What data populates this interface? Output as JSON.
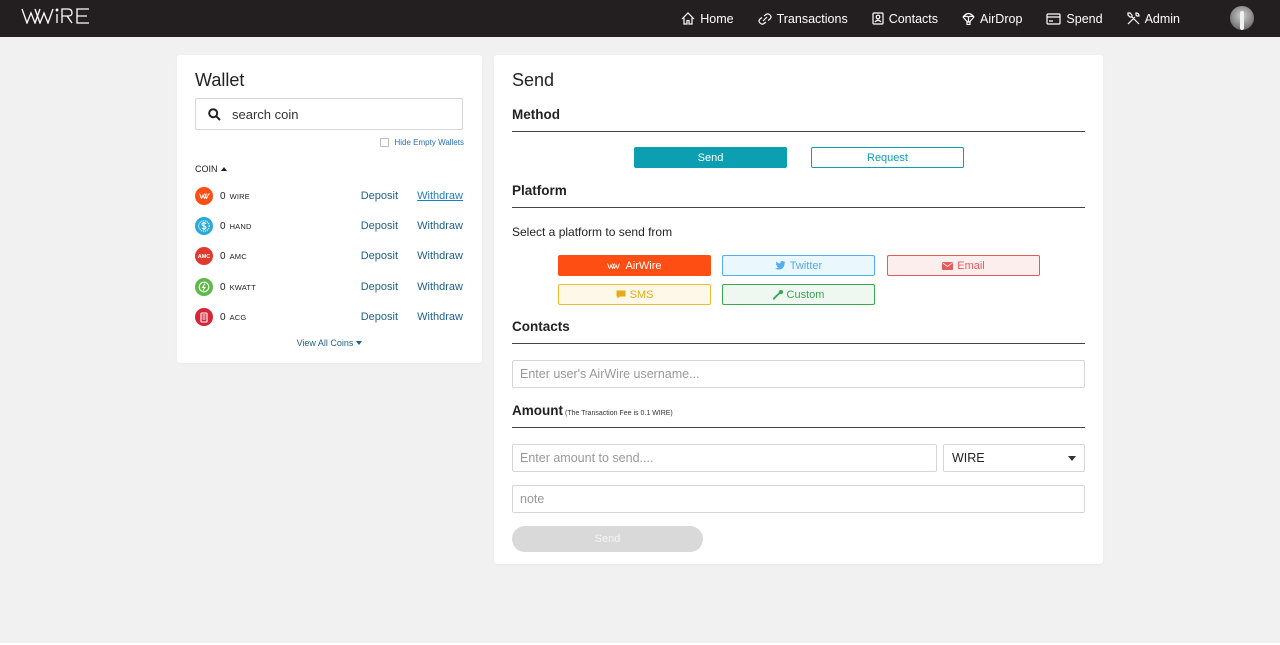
{
  "app": {
    "brand_colors": {
      "topbar": "#231f20",
      "accent": "#0c9eb1",
      "airwire": "#ff4e13"
    }
  },
  "nav": {
    "items": [
      {
        "label": "Home",
        "icon": "home-icon"
      },
      {
        "label": "Transactions",
        "icon": "link-icon"
      },
      {
        "label": "Contacts",
        "icon": "contact-card-icon"
      },
      {
        "label": "AirDrop",
        "icon": "parachute-icon"
      },
      {
        "label": "Spend",
        "icon": "credit-card-icon"
      },
      {
        "label": "Admin",
        "icon": "tools-icon"
      }
    ]
  },
  "wallet": {
    "title": "Wallet",
    "search_placeholder": "search coin",
    "hide_empty_label": "Hide Empty Wallets",
    "coin_header": "COIN",
    "coins": [
      {
        "amount": "0",
        "symbol": "WIRE",
        "color": "#ff4e13",
        "deposit": "Deposit",
        "withdraw": "Withdraw"
      },
      {
        "amount": "0",
        "symbol": "HAND",
        "color": "#2aa8d8",
        "deposit": "Deposit",
        "withdraw": "Withdraw"
      },
      {
        "amount": "0",
        "symbol": "AMC",
        "color": "#e03a2f",
        "deposit": "Deposit",
        "withdraw": "Withdraw"
      },
      {
        "amount": "0",
        "symbol": "KWATT",
        "color": "#5dba47",
        "deposit": "Deposit",
        "withdraw": "Withdraw"
      },
      {
        "amount": "0",
        "symbol": "ACG",
        "color": "#d6263a",
        "deposit": "Deposit",
        "withdraw": "Withdraw"
      }
    ],
    "view_all": "View All Coins"
  },
  "send": {
    "title": "Send",
    "method_title": "Method",
    "method_send": "Send",
    "method_request": "Request",
    "platform_title": "Platform",
    "platform_prompt": "Select a platform to send from",
    "platforms": {
      "airwire": "AirWire",
      "twitter": "Twitter",
      "email": "Email",
      "sms": "SMS",
      "custom": "Custom"
    },
    "contacts_title": "Contacts",
    "contact_placeholder": "Enter user's AirWire username...",
    "amount_title": "Amount",
    "fee_note": "(The Transaction Fee is 0.1 WIRE)",
    "amount_placeholder": "Enter amount to send....",
    "coin_selected": "WIRE",
    "note_placeholder": "note",
    "submit_label": "Send"
  }
}
